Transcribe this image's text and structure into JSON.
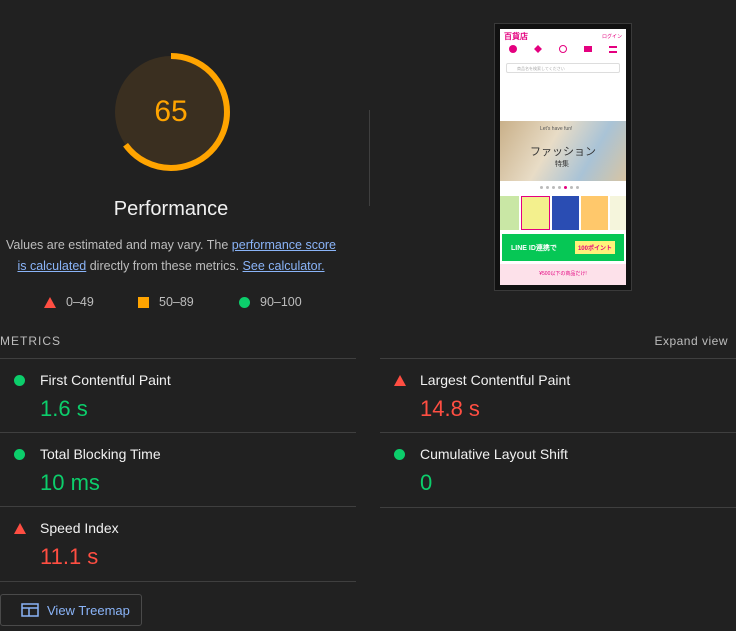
{
  "score": {
    "value": "65",
    "fraction": 0.65,
    "color": "#ffa400",
    "title": "Performance"
  },
  "description": {
    "prefix": "Values are estimated and may vary. The ",
    "link1": "performance score is calculated",
    "middle": " directly from these metrics. ",
    "link2": "See calculator."
  },
  "legend": {
    "fail": "0–49",
    "average": "50–89",
    "pass": "90–100"
  },
  "metrics_header": "METRICS",
  "expand_label": "Expand view",
  "metrics": [
    {
      "label": "First Contentful Paint",
      "value": "1.6 s",
      "status": "pass",
      "color": "#0cce6b"
    },
    {
      "label": "Largest Contentful Paint",
      "value": "14.8 s",
      "status": "fail",
      "color": "#ff4e42"
    },
    {
      "label": "Total Blocking Time",
      "value": "10 ms",
      "status": "pass",
      "color": "#0cce6b"
    },
    {
      "label": "Cumulative Layout Shift",
      "value": "0",
      "status": "pass",
      "color": "#0cce6b"
    },
    {
      "label": "Speed Index",
      "value": "11.1 s",
      "status": "fail",
      "color": "#ff4e42"
    }
  ],
  "treemap_button": "View Treemap",
  "screenshot": {
    "logo": "百貨店",
    "login": "ログイン",
    "nav": [
      "マイページ",
      "お気に入り",
      "閲覧履歴",
      "カート",
      "メニュー"
    ],
    "search_placeholder": "商品名を検索してください",
    "banner_tag": "Let's have fun!",
    "banner_title": "ファッション",
    "banner_sub": "特集",
    "line_banner": "LINE ID連携で",
    "line_banner_points": "100ポイント",
    "promo_text": "¥500以下の商品だけ!"
  }
}
